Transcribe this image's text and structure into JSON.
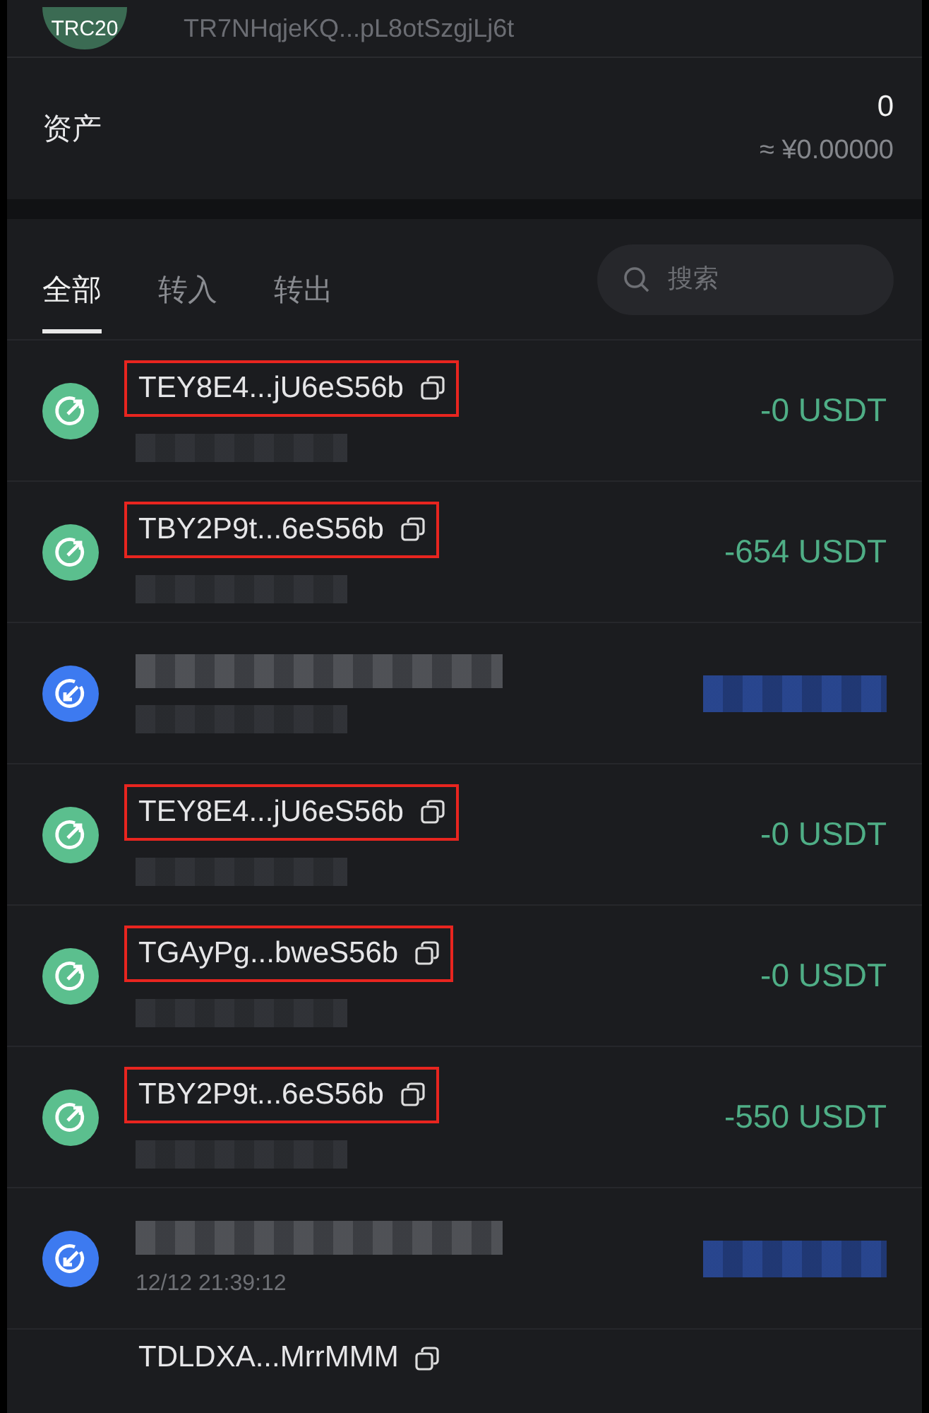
{
  "token": {
    "badge": "TRC20",
    "address": "TR7NHqjeKQ...pL8otSzgjLj6t"
  },
  "assets": {
    "label": "资产",
    "amount": "0",
    "fiat": "≈ ¥0.00000"
  },
  "tabs": [
    {
      "label": "全部",
      "selected": true
    },
    {
      "label": "转入",
      "selected": false
    },
    {
      "label": "转出",
      "selected": false
    }
  ],
  "search": {
    "placeholder": "搜索"
  },
  "transactions": [
    {
      "kind": "out",
      "address": "TEY8E4...jU6eS56b",
      "amount": "-0 USDT",
      "highlighted": true
    },
    {
      "kind": "out",
      "address": "TBY2P9t...6eS56b",
      "amount": "-654 USDT",
      "highlighted": true
    },
    {
      "kind": "in"
    },
    {
      "kind": "out",
      "address": "TEY8E4...jU6eS56b",
      "amount": "-0 USDT",
      "highlighted": true
    },
    {
      "kind": "out",
      "address": "TGAyPg...bweS56b",
      "amount": "-0 USDT",
      "highlighted": true
    },
    {
      "kind": "out",
      "address": "TBY2P9t...6eS56b",
      "amount": "-550 USDT",
      "highlighted": true
    },
    {
      "kind": "in",
      "time": "12/12 21:39:12"
    },
    {
      "kind": "none",
      "address": "TDLDXA...MrrMMM",
      "highlighted": false
    }
  ]
}
